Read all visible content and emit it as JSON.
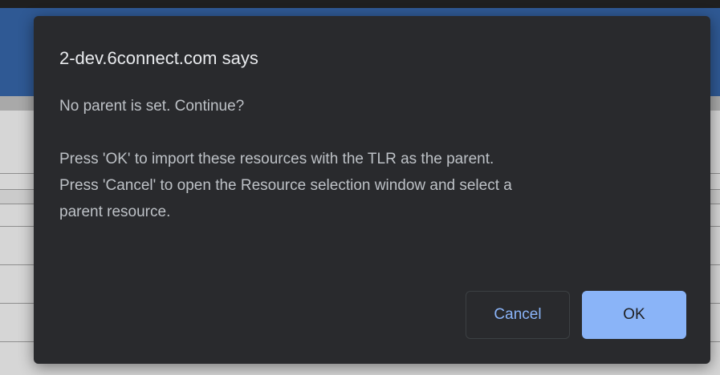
{
  "dialog": {
    "title": "2-dev.6connect.com says",
    "message_lines": [
      "No parent is set. Continue?",
      "",
      "Press 'OK' to import these resources with the TLR as the parent.",
      "Press 'Cancel' to open the Resource selection window and select a",
      "parent resource."
    ],
    "cancel_label": "Cancel",
    "ok_label": "OK"
  },
  "colors": {
    "dialog_bg": "#292a2d",
    "accent": "#8ab4f8",
    "title_text": "#e8eaed",
    "body_text": "#bdc1c6"
  }
}
